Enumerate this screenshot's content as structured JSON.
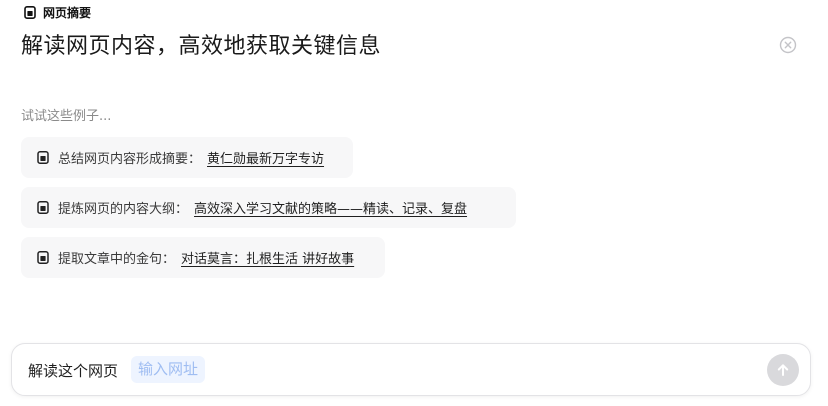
{
  "header": {
    "tag_label": "网页摘要",
    "tag_icon": "document-icon",
    "title": "解读网页内容，高效地获取关键信息",
    "close_icon": "close-circle-icon"
  },
  "hint": "试试这些例子...",
  "examples": [
    {
      "prefix": "总结网页内容形成摘要：",
      "link": "黄仁勋最新万字专访",
      "icon": "document-icon"
    },
    {
      "prefix": "提炼网页的内容大纲：",
      "link": "高效深入学习文献的策略——精读、记录、复盘",
      "icon": "document-icon"
    },
    {
      "prefix": "提取文章中的金句：",
      "link": "对话莫言：扎根生活 讲好故事",
      "icon": "document-icon"
    }
  ],
  "input": {
    "prefix": "解读这个网页",
    "url_placeholder": "输入网址",
    "send_icon": "arrow-up-icon"
  },
  "colors": {
    "chip_bg": "#f7f7f8",
    "url_slot_bg": "#eef4ff",
    "url_slot_text": "#9fbdf2",
    "send_btn_bg": "#d9d9dc"
  }
}
